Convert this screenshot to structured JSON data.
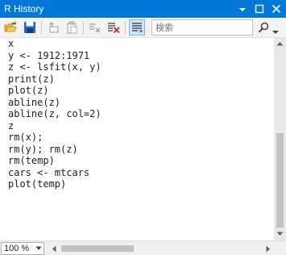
{
  "window": {
    "title": "R History",
    "title_bar_color": "#0078d7",
    "controls": [
      "dropdown-icon",
      "maximize-icon",
      "close-icon"
    ]
  },
  "toolbar": {
    "buttons": [
      {
        "icon": "open-folder-icon"
      },
      {
        "icon": "save-icon"
      },
      {
        "icon": "copy-to-console-icon"
      },
      {
        "icon": "paste-icon"
      },
      {
        "icon": "delete-entry-icon"
      },
      {
        "icon": "clear-all-icon"
      },
      {
        "icon": "word-wrap-icon",
        "active": true
      }
    ],
    "search": {
      "placeholder": "検索",
      "value": ""
    }
  },
  "history": {
    "lines": [
      "x",
      "y <- 1912:1971",
      "z <- lsfit(x, y)",
      "print(z)",
      "plot(z)",
      "abline(z)",
      "abline(z, col=2)",
      "z",
      "rm(x);",
      "rm(y); rm(z)",
      "rm(temp)",
      "cars <- mtcars",
      "plot(temp)"
    ]
  },
  "status": {
    "zoom": "100 %"
  },
  "scroll": {
    "vertical_position": 0.47,
    "horizontal_position": 0.0
  }
}
